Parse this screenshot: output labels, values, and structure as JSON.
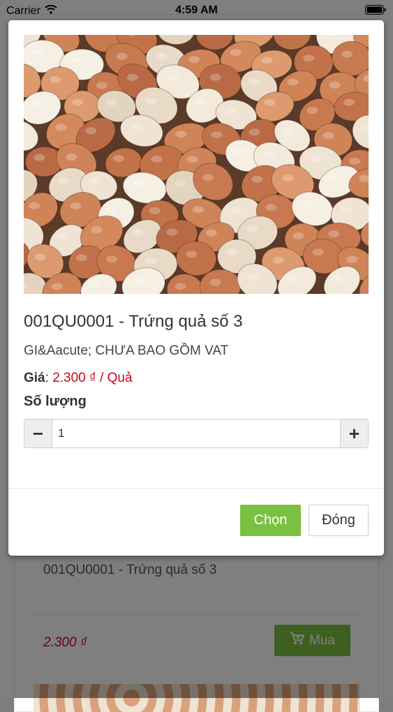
{
  "status_bar": {
    "carrier": "Carrier",
    "time": "4:59 AM"
  },
  "background": {
    "product_title": "001QU0001 - Trứng quả số 3",
    "price": "2.300 ₫",
    "buy_label": "Mua"
  },
  "modal": {
    "image_icon": "eggs-photo",
    "title": "001QU0001 - Trứng quả số 3",
    "subtitle": "GI&Aacute; CHƯA BAO GỒM VAT",
    "price_label": "Giá",
    "price_separator": ":",
    "price_value": "2.300 ₫ / Quả",
    "quantity_label": "Số lượng",
    "quantity_value": "1",
    "minus_symbol": "−",
    "plus_symbol": "+",
    "select_label": "Chọn",
    "close_label": "Đóng"
  },
  "colors": {
    "accent_green": "#7ac143",
    "price_red": "#d0021b"
  }
}
